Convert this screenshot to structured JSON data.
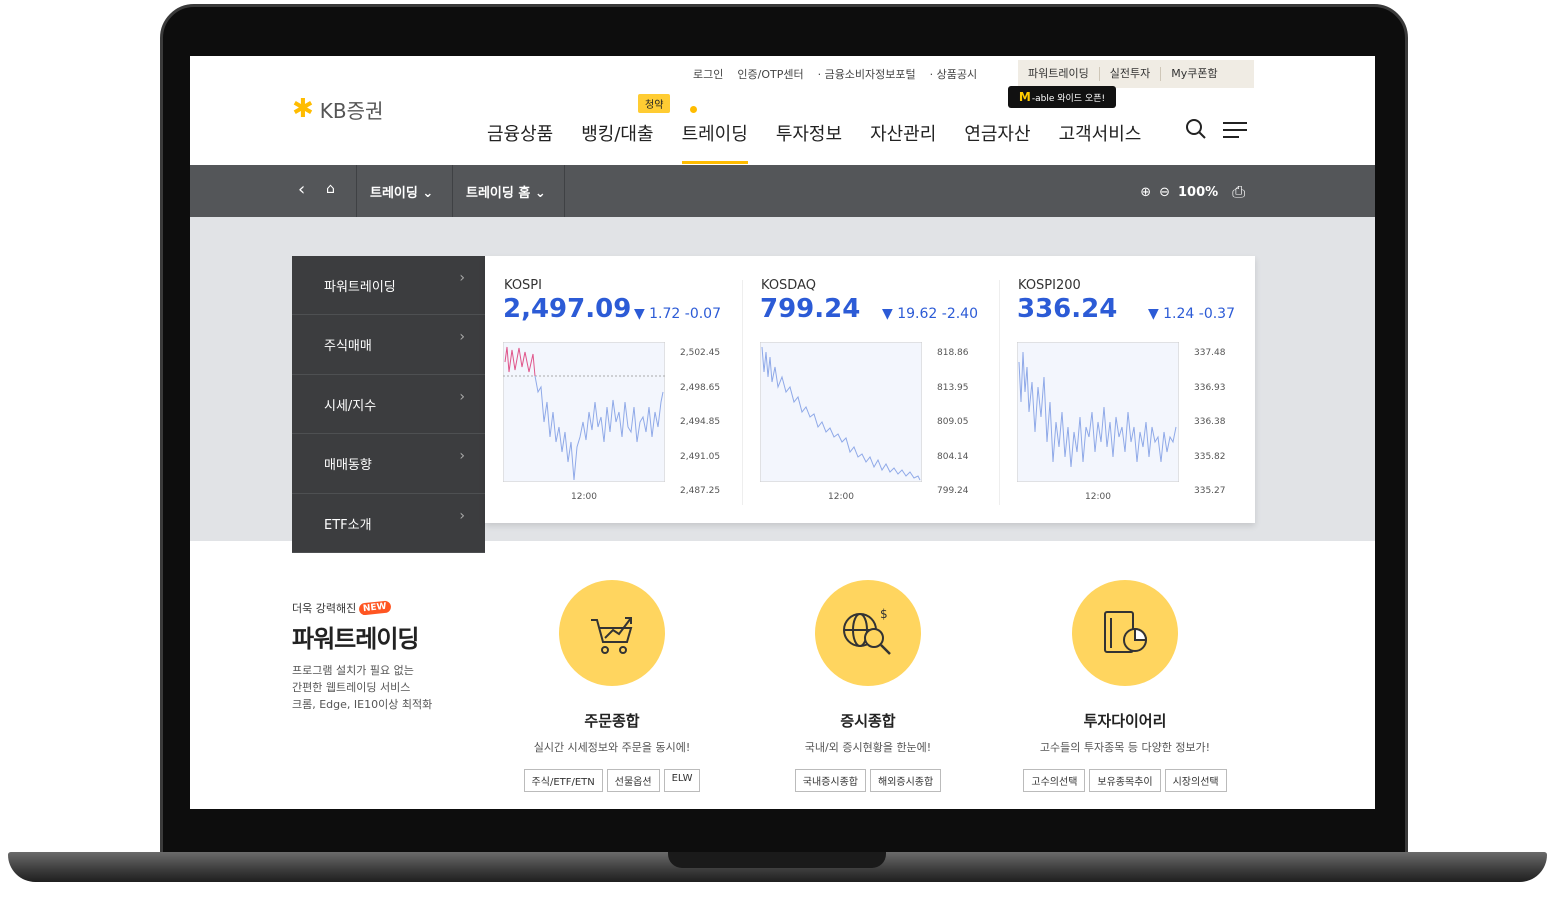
{
  "util_links": [
    "로그인",
    "인증/OTP센터",
    "· 금융소비자정보포털",
    "· 상품공시"
  ],
  "util_box": [
    "파워트레이딩",
    "실전투자",
    "My쿠폰함"
  ],
  "tooltip": {
    "brand": "M",
    "text": "-able 와이드 오픈!"
  },
  "logo": {
    "symbol": "✱",
    "text": "KB증권"
  },
  "gnb": [
    "금융상품",
    "뱅킹/대출",
    "트레이딩",
    "투자정보",
    "자산관리",
    "연금자산",
    "고객서비스"
  ],
  "badge": "청약",
  "locbar": {
    "back": "‹",
    "home": "⌂",
    "crumb1": "트레이딩 ⌄",
    "crumb2": "트레이딩 홈 ⌄",
    "zoom_in": "⊕",
    "zoom_out": "⊖",
    "zoom": "100%",
    "print": "⎙"
  },
  "sidemenu": [
    "파워트레이딩",
    "주식매매",
    "시세/지수",
    "매매동향",
    "ETF소개"
  ],
  "indices": [
    {
      "name": "KOSPI",
      "value": "2,497.09",
      "change": "▼ 1.72  -0.07",
      "ticks": [
        "2,502.45",
        "2,498.65",
        "2,494.85",
        "2,491.05",
        "2,487.25"
      ],
      "time": "12:00"
    },
    {
      "name": "KOSDAQ",
      "value": "799.24",
      "change": "▼ 19.62  -2.40",
      "ticks": [
        "818.86",
        "813.95",
        "809.05",
        "804.14",
        "799.24"
      ],
      "time": "12:00"
    },
    {
      "name": "KOSPI200",
      "value": "336.24",
      "change": "▼ 1.24  -0.37",
      "ticks": [
        "337.48",
        "336.93",
        "336.38",
        "335.82",
        "335.27"
      ],
      "time": "12:00"
    }
  ],
  "powertrading": {
    "small": "더욱 강력해진",
    "new": "NEW",
    "title": "파워트레이딩",
    "desc1": "프로그램 설치가 필요 없는",
    "desc2": "간편한 웹트레이딩 서비스",
    "desc3": "크롬, Edge, IE10이상 최적화"
  },
  "features": [
    {
      "title": "주문종합",
      "desc": "실시간 시세정보와 주문을 동시에!",
      "tags": [
        "주식/ETF/ETN",
        "선물옵션",
        "ELW"
      ]
    },
    {
      "title": "증시종합",
      "desc": "국내/외 증시현황을 한눈에!",
      "tags": [
        "국내증시종합",
        "해외증시종합"
      ]
    },
    {
      "title": "투자다이어리",
      "desc": "고수들의 투자종목 등 다양한 정보가!",
      "tags": [
        "고수의선택",
        "보유종목추이",
        "시장의선택"
      ]
    }
  ]
}
